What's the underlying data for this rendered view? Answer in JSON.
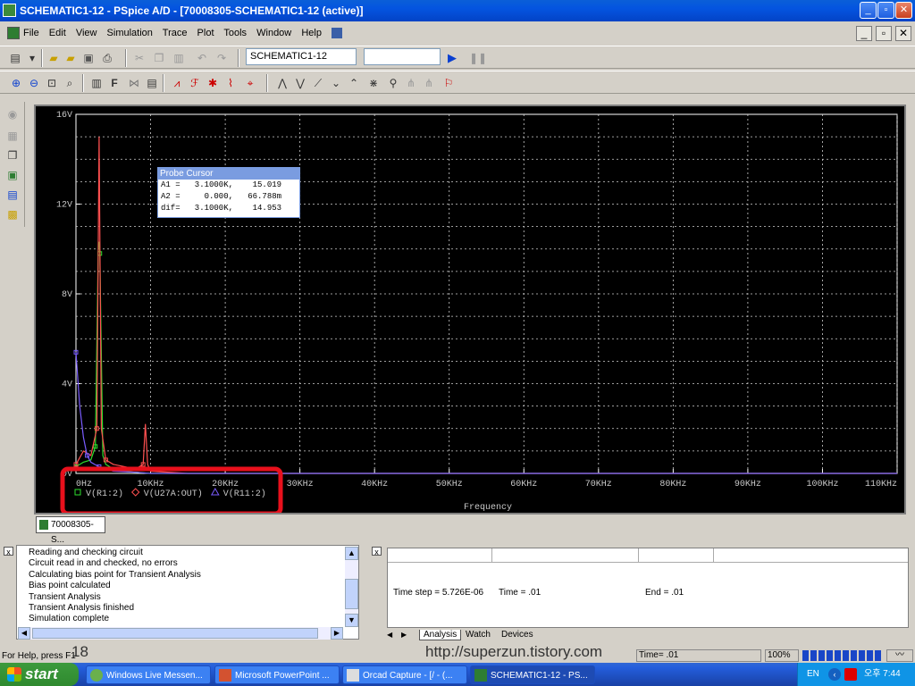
{
  "window": {
    "title": "SCHEMATIC1-12 - PSpice A/D  - [70008305-SCHEMATIC1-12 (active)]"
  },
  "menu": [
    "File",
    "Edit",
    "View",
    "Simulation",
    "Trace",
    "Plot",
    "Tools",
    "Window",
    "Help"
  ],
  "toolbar": {
    "profile": "SCHEMATIC1-12"
  },
  "plot": {
    "y_ticks": [
      "16V",
      "12V",
      "8V",
      "4V",
      "0V"
    ],
    "x_ticks": [
      "0Hz",
      "10KHz",
      "20KHz",
      "30KHz",
      "40KHz",
      "50KHz",
      "60KHz",
      "70KHz",
      "80KHz",
      "90KHz",
      "100KHz",
      "110KHz"
    ],
    "xlabel": "Frequency",
    "legend": [
      {
        "marker": "square",
        "color": "#2ee02e",
        "label": "V(R1:2)"
      },
      {
        "marker": "diamond",
        "color": "#ff5050",
        "label": "V(U27A:OUT)"
      },
      {
        "marker": "triangle",
        "color": "#7a5cff",
        "label": "V(R11:2)"
      }
    ],
    "probe_cursor": {
      "title": "Probe Cursor",
      "rows": [
        {
          "name": "A1 =",
          "x": "3.1000K,",
          "y": "15.019"
        },
        {
          "name": "A2 =",
          "x": "0.000,",
          "y": "66.788m"
        },
        {
          "name": "dif=",
          "x": "3.1000K,",
          "y": "14.953"
        }
      ]
    },
    "highlight_color": "#e8101c"
  },
  "chart_data": {
    "type": "line",
    "xlabel": "Frequency",
    "xlim": [
      0,
      110000
    ],
    "ylim": [
      0,
      16
    ],
    "grid": true,
    "legend_position": "bottom-left",
    "series": [
      {
        "name": "V(R1:2)",
        "color": "#2ee02e",
        "x": [
          0,
          1000,
          2000,
          2600,
          3000,
          3100,
          3200,
          3600,
          4000,
          5000,
          6000,
          8000,
          10000,
          35000,
          110000
        ],
        "y": [
          0.3,
          0.5,
          0.6,
          1.2,
          10.3,
          10.3,
          9.8,
          0.8,
          0.4,
          0.2,
          0.1,
          0.05,
          0,
          0,
          0
        ]
      },
      {
        "name": "V(U27A:OUT)",
        "color": "#ff5050",
        "x": [
          0,
          1000,
          2000,
          2800,
          3100,
          3400,
          4000,
          5000,
          8000,
          9000,
          9300,
          9600,
          10000,
          15000,
          110000
        ],
        "y": [
          0.4,
          1.0,
          0.8,
          2.0,
          15.0,
          2.0,
          0.6,
          0.4,
          0.2,
          0.4,
          2.2,
          0.4,
          0.1,
          0,
          0
        ]
      },
      {
        "name": "V(R11:2)",
        "color": "#7a5cff",
        "x": [
          0,
          500,
          1000,
          1500,
          2000,
          2500,
          3100,
          4000,
          5000,
          8000,
          10000,
          110000
        ],
        "y": [
          5.4,
          3.0,
          1.6,
          0.8,
          0.5,
          0.4,
          0.3,
          0.2,
          0.1,
          0.05,
          0,
          0
        ]
      }
    ]
  },
  "doc_tab": {
    "label": "70008305-S..."
  },
  "output": [
    "Reading and checking circuit",
    "Circuit read in and checked, no errors",
    "Calculating bias point for Transient Analysis",
    "Bias point calculated",
    "Transient Analysis",
    "Transient Analysis finished",
    "Simulation complete"
  ],
  "sim": {
    "time_step": "Time step =  5.726E-06",
    "time": "Time =  .01",
    "end": "End =  .01",
    "tabs": [
      "Analysis",
      "Watch",
      "Devices"
    ]
  },
  "status": {
    "help": "For Help, press F1",
    "page_number": "18",
    "url": "http://superzun.tistory.com",
    "time": "Time= .01",
    "zoom": "100%"
  },
  "taskbar": {
    "start": "start",
    "tasks": [
      "Windows Live Messen...",
      "Microsoft PowerPoint ...",
      "Orcad Capture - [/ - (...",
      "SCHEMATIC1-12 - PS..."
    ],
    "lang": "EN",
    "clock": "오후 7:44"
  }
}
